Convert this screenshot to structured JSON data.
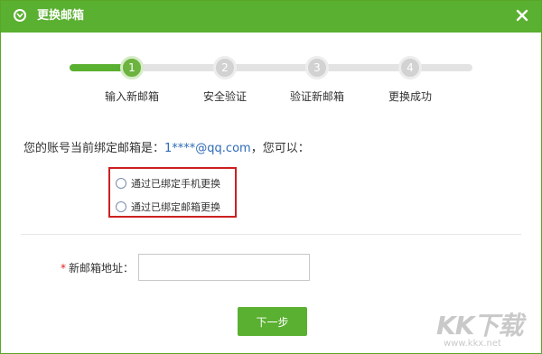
{
  "dialog": {
    "title": "更换邮箱",
    "close_icon": "close-icon",
    "title_icon": "chevron-down-circle-icon"
  },
  "steps": [
    {
      "number": "1",
      "label": "输入新邮箱",
      "active": true
    },
    {
      "number": "2",
      "label": "安全验证",
      "active": false
    },
    {
      "number": "3",
      "label": "验证新邮箱",
      "active": false
    },
    {
      "number": "4",
      "label": "更换成功",
      "active": false
    }
  ],
  "account": {
    "prefix": "您的账号当前绑定邮箱是：",
    "email": "1****@qq.com",
    "suffix": "，您可以："
  },
  "options": [
    {
      "label": "通过已绑定手机更换"
    },
    {
      "label": "通过已绑定邮箱更换"
    }
  ],
  "form": {
    "required_mark": "*",
    "new_email_label": "新邮箱地址：",
    "new_email_value": "",
    "new_email_placeholder": ""
  },
  "actions": {
    "next_label": "下一步"
  },
  "watermark": {
    "big": "KK下载",
    "small": "www.kkx.net"
  },
  "colors": {
    "accent": "#5ab030",
    "highlight_border": "#cc2020",
    "link": "#2f6bb6"
  }
}
